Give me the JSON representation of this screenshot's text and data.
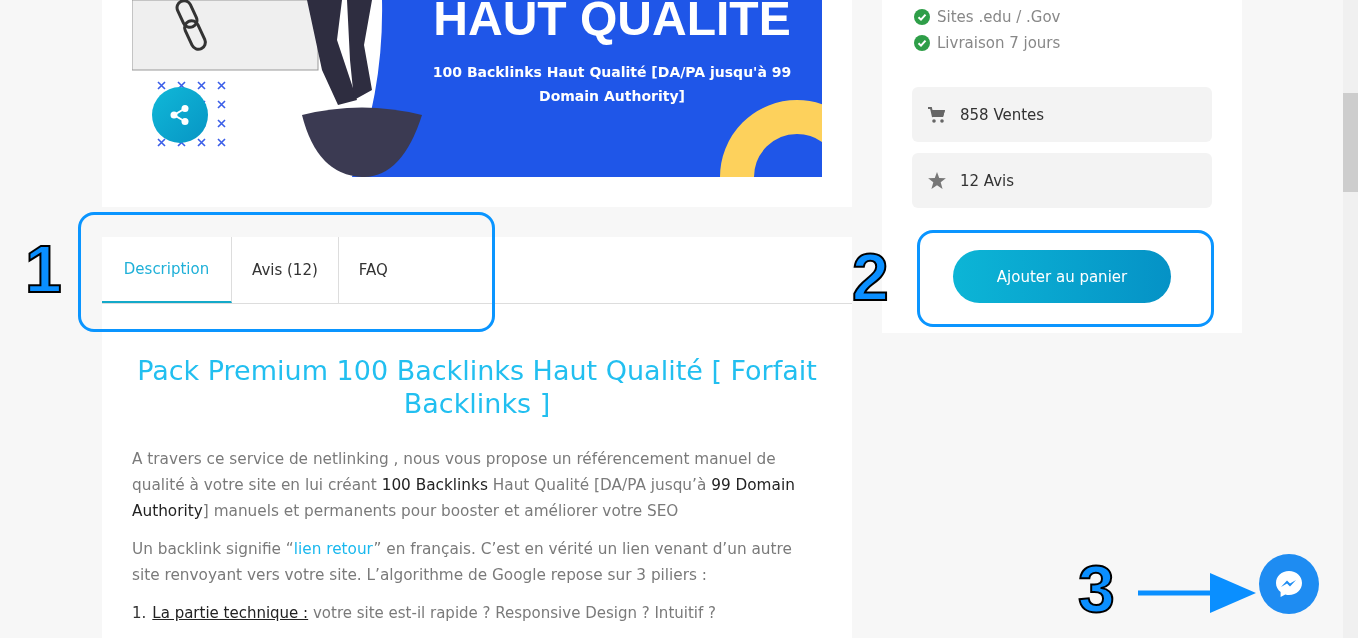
{
  "product_image": {
    "headline": "HAUT QUALITE",
    "subtitle": "100 Backlinks Haut Qualité [DA/PA jusqu'à 99 Domain Authority]"
  },
  "tabs": [
    {
      "label": "Description",
      "selected": true
    },
    {
      "label": "Avis (12)",
      "selected": false
    },
    {
      "label": "FAQ",
      "selected": false
    }
  ],
  "description": {
    "title": "Pack Premium 100 Backlinks Haut Qualité [ Forfait Backlinks ]",
    "paragraphs": [
      [
        {
          "text": "A travers ce service de netlinking , nous vous propose un référencement manuel de qualité à votre site en lui créant **100 Backlinks** Haut Qualité [DA/PA jusqu’à **99 Domain Authority**] manuels et permanents pour booster et améliorer votre SEO"
        }
      ],
      [
        {
          "text": "Un backlink signifie “"
        },
        {
          "text": "lien retour",
          "kind": "link"
        },
        {
          "text": "” en français. C’est en vérité un lien venant d’un autre site renvoyant vers votre site. L’algorithme de Google repose sur 3 piliers :"
        }
      ]
    ],
    "list": [
      {
        "number": "1.",
        "term": "La partie technique :",
        "text": " votre site est-il rapide ? Responsive Design ? Intuitif ?"
      }
    ]
  },
  "sidebar": {
    "features": [
      "Sites .edu / .Gov",
      "Livraison 7 jours"
    ],
    "stats": [
      {
        "kind": "sales",
        "text": "858 Ventes"
      },
      {
        "kind": "reviews",
        "text": "12 Avis"
      }
    ],
    "cart_button": "Ajouter au panier"
  },
  "annotations": [
    {
      "label": "1"
    },
    {
      "label": "2"
    },
    {
      "label": "3"
    }
  ]
}
